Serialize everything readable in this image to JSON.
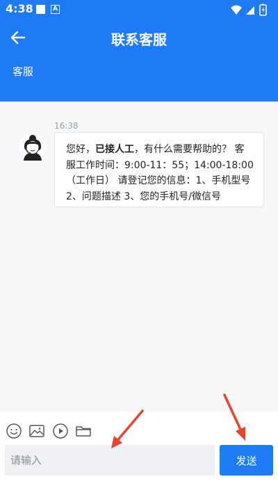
{
  "status_bar": {
    "time": "4:38"
  },
  "header": {
    "title": "联系客服",
    "tab": "客服"
  },
  "chat": {
    "timestamp": "16:38",
    "message_part1": "您好，",
    "message_bold": "已接人工",
    "message_part2": "，有什么需要帮助的？ 客服工作时间：9:00-11：55；14:00-18:00（工作日） 请登记您的信息：1、手机型号 2、问题描述 3、您的手机号/微信号"
  },
  "composer": {
    "placeholder": "请输入",
    "send_label": "发送"
  },
  "colors": {
    "primary": "#1e7bf5",
    "annotation_arrow": "#e8432e"
  }
}
